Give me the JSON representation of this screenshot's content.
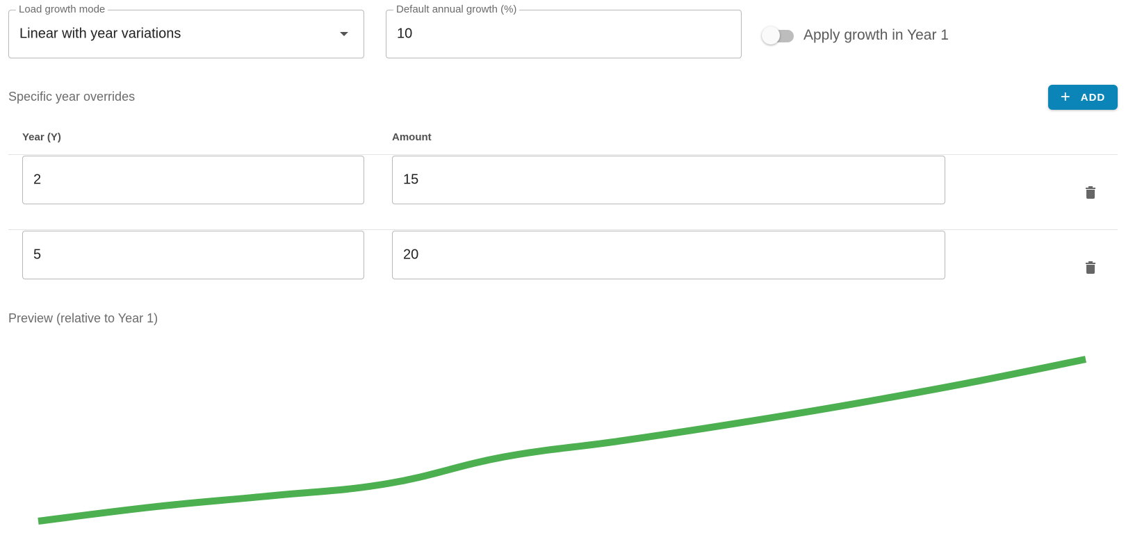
{
  "load_growth_mode": {
    "label": "Load growth mode",
    "value": "Linear with year variations"
  },
  "default_annual_growth": {
    "label": "Default annual growth (%)",
    "value": "10"
  },
  "apply_growth_year1": {
    "label": "Apply growth in Year 1",
    "checked": false
  },
  "overrides": {
    "label": "Specific year overrides",
    "add_label": "ADD",
    "columns": {
      "year": "Year (Y)",
      "amount": "Amount"
    },
    "rows": [
      {
        "year": "2",
        "amount": "15"
      },
      {
        "year": "5",
        "amount": "20"
      }
    ]
  },
  "preview": {
    "label": "Preview (relative to Year 1)"
  },
  "chart_data": {
    "type": "line",
    "x": [
      1,
      2,
      3,
      4,
      5,
      6,
      7,
      8,
      9,
      10
    ],
    "series": [
      {
        "values": [
          1.0,
          1.15,
          1.265,
          1.392,
          1.67,
          1.837,
          2.021,
          2.223,
          2.445,
          2.69
        ],
        "color": "#4caf50"
      }
    ],
    "title": "",
    "xlabel": "",
    "ylabel": "",
    "grid": false,
    "axes_visible": false
  },
  "colors": {
    "accent": "#0b85b8",
    "line": "#4caf50",
    "border": "#b8b8b8"
  },
  "icons": {
    "dropdown": "caret-down-icon",
    "add": "plus-icon",
    "delete": "trash-icon"
  }
}
